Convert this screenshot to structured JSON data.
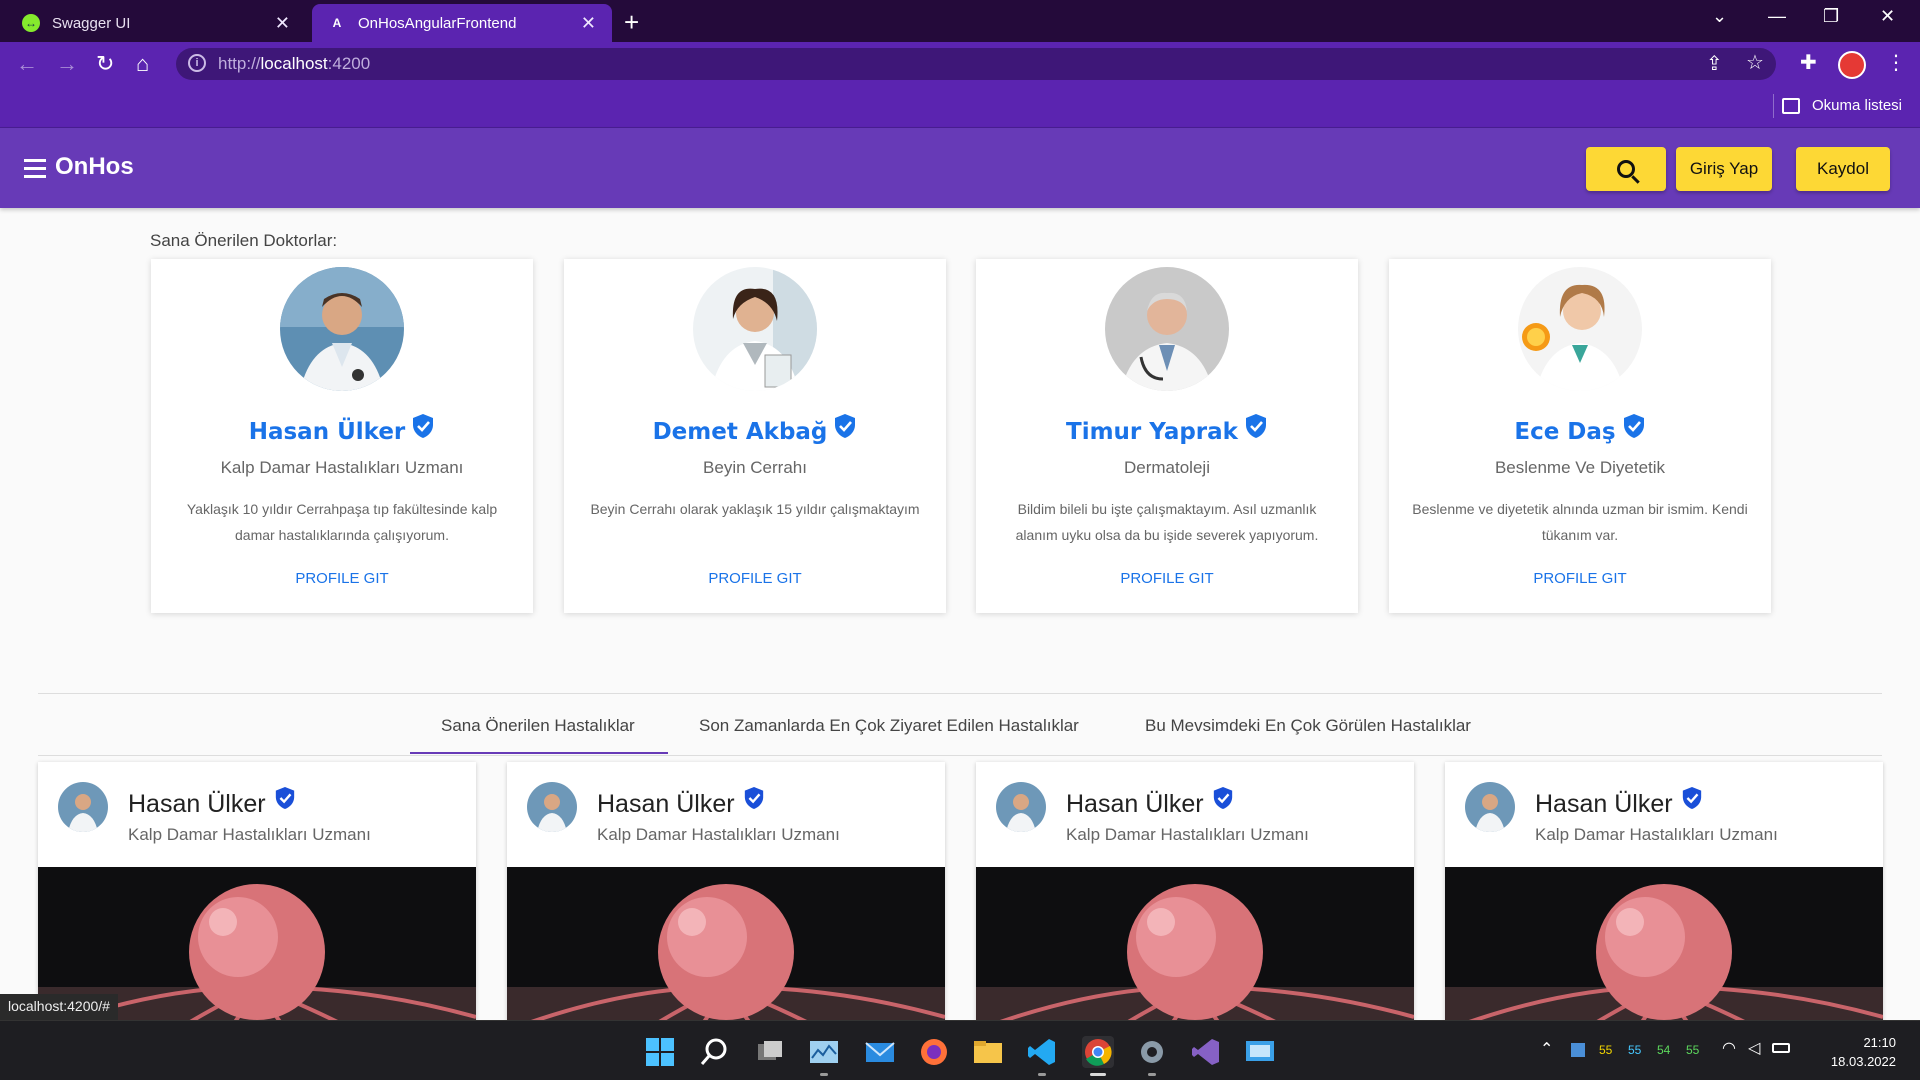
{
  "browser": {
    "tabs": [
      {
        "title": "Swagger UI",
        "favicon": "swagger-icon",
        "active": false
      },
      {
        "title": "OnHosAngularFrontend",
        "favicon": "angular-icon",
        "active": true
      }
    ],
    "address": {
      "scheme": "http://",
      "host": "localhost",
      "port": ":4200"
    },
    "reading_list": "Okuma listesi",
    "status_link": "localhost:4200/#"
  },
  "app": {
    "brand": "OnHos",
    "login_label": "Giriş Yap",
    "register_label": "Kaydol",
    "colors": {
      "primary": "#673ab7",
      "accent": "#fdd835",
      "link": "#1a73e8"
    }
  },
  "recommended": {
    "title": "Sana Önerilen Doktorlar:",
    "doctors": [
      {
        "name": "Hasan Ülker",
        "specialty": "Kalp Damar Hastalıkları Uzmanı",
        "bio": "Yaklaşık 10 yıldır Cerrahpaşa tıp fakültesinde kalp damar hastalıklarında çalışıyorum.",
        "link": "PROFILE GIT"
      },
      {
        "name": "Demet Akbağ",
        "specialty": "Beyin Cerrahı",
        "bio": "Beyin Cerrahı olarak yaklaşık 15 yıldır çalışmaktayım",
        "link": "PROFILE GIT"
      },
      {
        "name": "Timur Yaprak",
        "specialty": "Dermatoleji",
        "bio": "Bildim bileli bu işte çalışmaktayım. Asıl uzmanlık alanım uyku olsa da bu işide severek yapıyorum.",
        "link": "PROFILE GIT"
      },
      {
        "name": "Ece Daş",
        "specialty": "Beslenme Ve Diyetetik",
        "bio": "Beslenme ve diyetetik alnında uzman bir ismim. Kendi tükanım var.",
        "link": "PROFILE GIT"
      }
    ]
  },
  "disease_tabs": [
    {
      "label": "Sana Önerilen Hastalıklar",
      "active": true
    },
    {
      "label": "Son Zamanlarda En Çok Ziyaret Edilen Hastalıklar",
      "active": false
    },
    {
      "label": "Bu Mevsimdeki En Çok Görülen Hastalıklar",
      "active": false
    }
  ],
  "disease_cards": [
    {
      "author": "Hasan Ülker",
      "specialty": "Kalp Damar Hastalıkları Uzmanı"
    },
    {
      "author": "Hasan Ülker",
      "specialty": "Kalp Damar Hastalıkları Uzmanı"
    },
    {
      "author": "Hasan Ülker",
      "specialty": "Kalp Damar Hastalıkları Uzmanı"
    },
    {
      "author": "Hasan Ülker",
      "specialty": "Kalp Damar Hastalıkları Uzmanı"
    }
  ],
  "taskbar": {
    "tray_numbers": [
      "55",
      "55",
      "54",
      "55"
    ],
    "time": "21:10",
    "date": "18.03.2022"
  }
}
